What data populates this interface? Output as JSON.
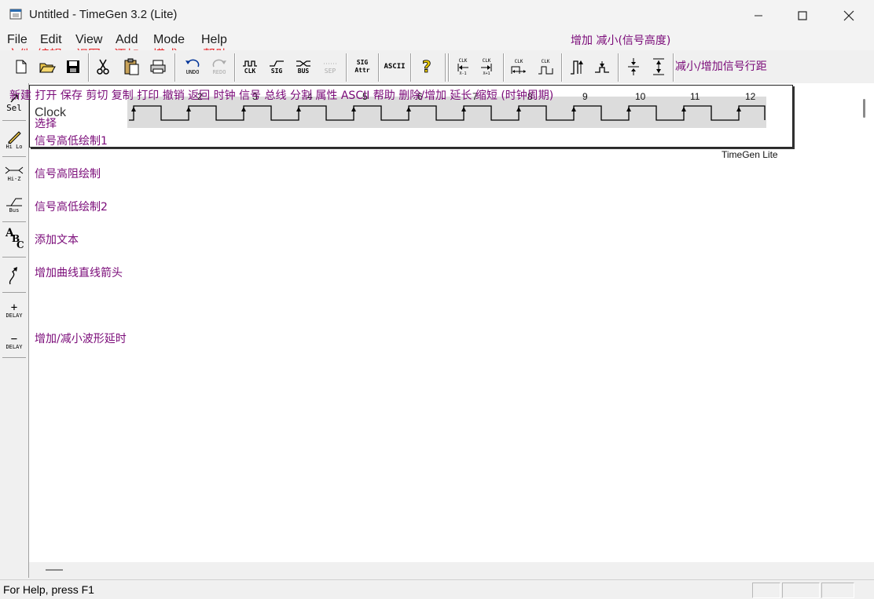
{
  "window": {
    "title": "Untitled - TimeGen 3.2 (Lite)"
  },
  "menubar": {
    "items": [
      {
        "label": "File",
        "annotation": "文件"
      },
      {
        "label": "Edit",
        "annotation": "编辑"
      },
      {
        "label": "View",
        "annotation": "视图"
      },
      {
        "label": "Add",
        "annotation": "添加"
      },
      {
        "label": "Mode",
        "annotation": "模式"
      },
      {
        "label": "Help",
        "annotation": "帮助"
      }
    ],
    "annotation_height": "增加 减小(信号高度)"
  },
  "toolbar": {
    "undo_label": "UNDO",
    "redo_label": "REDO",
    "clk_label": "CLK",
    "sig_label": "SIG",
    "bus_label": "BUS",
    "sep_label": "SEP",
    "sig_attr_label_1": "SIG",
    "sig_attr_label_2": "Attr",
    "ascii_label": "ASCII",
    "clk_small": "CLK",
    "xminus": "X-1",
    "xplus": "X+1",
    "annotation_row_spacing": "减小/增加信号行距"
  },
  "toolbar_annotations": {
    "row": "新建 打开 保存 剪切 复制 打印   撤销  返回  时钟 信号 总线 分割   属性  ASCII 帮助   删除/增加  延长  缩短  (时钟周期)"
  },
  "left_tools": {
    "sel": "Sel",
    "hilo": "Hi Lo",
    "hiz": "Hi-Z",
    "bus": "Bus",
    "delay_plus": "DELAY",
    "delay_minus": "DELAY"
  },
  "left_annotations": {
    "select": "选择",
    "hilo1": "信号高低绘制1",
    "hiz": "信号高阻绘制",
    "hilo2": "信号高低绘制2",
    "text": "添加文本",
    "arrow": "增加曲线直线箭头",
    "delay": "增加/减小波形延时"
  },
  "diagram": {
    "signal_name": "Clock",
    "tick_labels": [
      "2",
      "3",
      "4",
      "5",
      "6",
      "7",
      "8",
      "9",
      "10",
      "11",
      "12"
    ],
    "watermark": "TimeGen Lite"
  },
  "statusbar": {
    "text": "For Help, press F1"
  }
}
